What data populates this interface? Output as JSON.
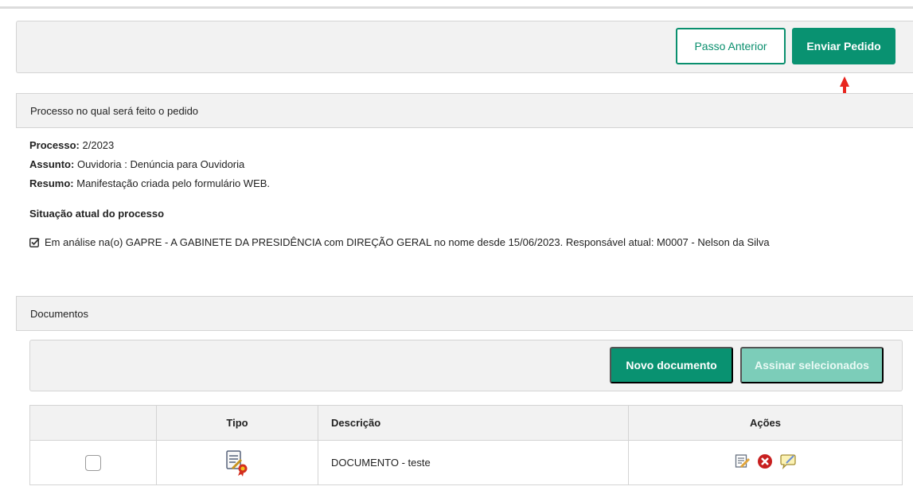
{
  "toolbar": {
    "prev_label": "Passo Anterior",
    "send_label": "Enviar Pedido"
  },
  "process_section": {
    "title": "Processo no qual será feito o pedido",
    "processo_label": "Processo:",
    "processo_value": "2/2023",
    "assunto_label": "Assunto:",
    "assunto_value": "Ouvidoria : Denúncia para Ouvidoria",
    "resumo_label": "Resumo:",
    "resumo_value": "Manifestação criada pelo formulário WEB.",
    "situacao_title": "Situação atual do processo",
    "situacao_text": "Em análise na(o) GAPRE - A GABINETE DA PRESIDÊNCIA com DIREÇÃO GERAL no nome desde 15/06/2023. Responsável atual: M0007 - Nelson da Silva"
  },
  "documents_section": {
    "title": "Documentos",
    "new_doc_label": "Novo documento",
    "sign_selected_label": "Assinar selecionados",
    "columns": [
      "",
      "Tipo",
      "Descrição",
      "Ações"
    ],
    "rows": [
      {
        "description": "DOCUMENTO - teste",
        "type_icon": "signed-document-icon",
        "actions": [
          "edit-icon",
          "delete-icon",
          "comment-icon"
        ]
      }
    ]
  },
  "colors": {
    "accent": "#099271",
    "accent_disabled": "#7ccdb9",
    "panel_bg": "#f2f2f2",
    "annotation_arrow": "#e8261f"
  }
}
